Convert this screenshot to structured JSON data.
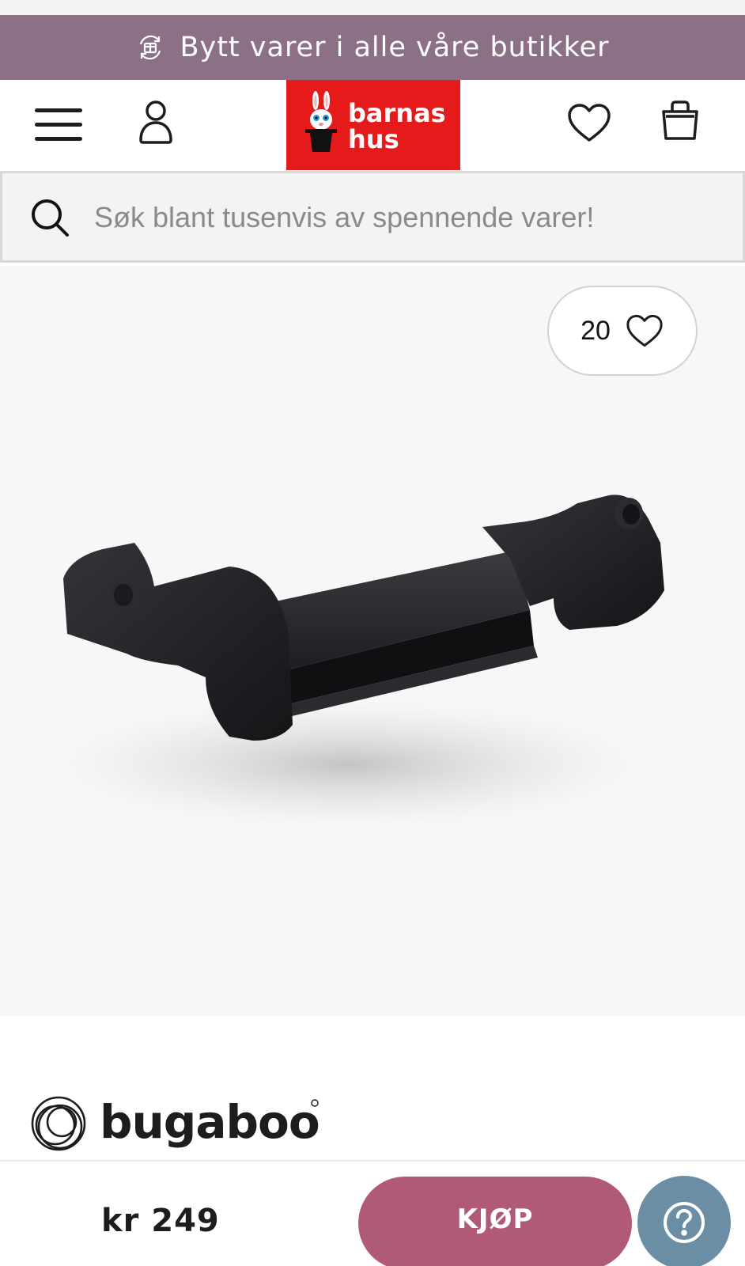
{
  "colors": {
    "promo_bg": "#8c7186",
    "logo_bg": "#e51b1b",
    "buy_button_bg": "#b05a78",
    "help_button_bg": "#6c8ea5"
  },
  "promo": {
    "icon": "exchange-icon",
    "text": "Bytt varer i alle våre butikker"
  },
  "header": {
    "menu_icon": "hamburger-menu-icon",
    "account_icon": "user-icon",
    "logo_text_line1": "barnas",
    "logo_text_line2": "hus",
    "wishlist_icon": "heart-icon",
    "cart_icon": "shopping-bag-icon"
  },
  "search": {
    "icon": "search-icon",
    "placeholder": "Søk blant tusenvis av spennende varer!",
    "value": ""
  },
  "product": {
    "like_count": "20",
    "brand": "bugaboo",
    "price": "kr 249"
  },
  "actions": {
    "buy_label": "KJØP",
    "help_icon": "question-mark-icon"
  }
}
